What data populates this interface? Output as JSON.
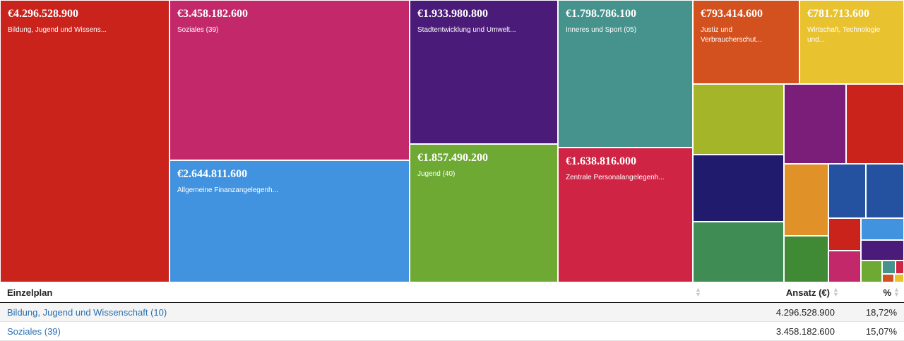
{
  "chart_data": {
    "type": "treemap",
    "currency": "€",
    "tiles": [
      {
        "amount": "€4.296.528.900",
        "label": "Bildung, Jugend und Wissens...",
        "value": 4296528900,
        "color": "#c9231c"
      },
      {
        "amount": "€3.458.182.600",
        "label": "Soziales (39)",
        "value": 3458182600,
        "color": "#c2286a"
      },
      {
        "amount": "€2.644.811.600",
        "label": "Allgemeine Finanzangelegenh...",
        "value": 2644811600,
        "color": "#4293df"
      },
      {
        "amount": "€1.933.980.800",
        "label": "Stadtentwicklung und Umwelt...",
        "value": 1933980800,
        "color": "#4a1b78"
      },
      {
        "amount": "€1.857.490.200",
        "label": "Jugend (40)",
        "value": 1857490200,
        "color": "#6ea934"
      },
      {
        "amount": "€1.798.786.100",
        "label": "Inneres und Sport (05)",
        "value": 1798786100,
        "color": "#46938d"
      },
      {
        "amount": "€1.638.816.000",
        "label": "Zentrale Personalangelegenh...",
        "value": 1638816000,
        "color": "#d02445"
      },
      {
        "amount": "€793.414.600",
        "label": "Justiz und Verbraucherschut...",
        "value": 793414600,
        "color": "#d2511f"
      },
      {
        "amount": "€781.713.600",
        "label": "Wirtschaft, Technologie und...",
        "value": 781713600,
        "color": "#e9c22f"
      },
      {
        "color": "#a5b52a"
      },
      {
        "color": "#7a1e79"
      },
      {
        "color": "#c9231c"
      },
      {
        "color": "#211b6e"
      },
      {
        "color": "#e09228"
      },
      {
        "color": "#2452a0"
      },
      {
        "color": "#2452a0"
      },
      {
        "color": "#3f8c54"
      },
      {
        "color": "#c9231c"
      },
      {
        "color": "#4293df"
      },
      {
        "color": "#408a35"
      },
      {
        "color": "#4a1b78"
      },
      {
        "color": "#c2286a"
      },
      {
        "color": "#6ea934"
      },
      {
        "color": "#46938d"
      },
      {
        "color": "#d02445"
      },
      {
        "color": "#d2511f"
      },
      {
        "color": "#e9c22f"
      }
    ]
  },
  "table": {
    "headers": {
      "name": "Einzelplan",
      "amount": "Ansatz (€)",
      "percent": "%"
    },
    "rows": [
      {
        "name": "Bildung, Jugend und Wissenschaft (10)",
        "amount": "4.296.528.900",
        "percent": "18,72%"
      },
      {
        "name": "Soziales (39)",
        "amount": "3.458.182.600",
        "percent": "15,07%"
      }
    ]
  }
}
